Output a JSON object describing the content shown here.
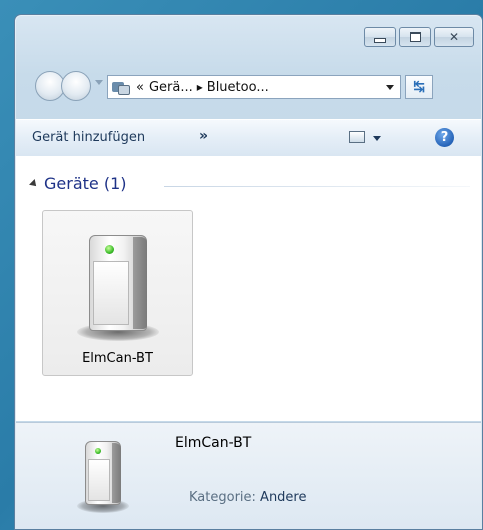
{
  "window": {
    "caption_buttons": [
      "minimize",
      "maximize",
      "close"
    ]
  },
  "address": {
    "overflow_chevron": "«",
    "crumbs": [
      "Gerä...",
      "Bluetoo..."
    ],
    "separator": "▸"
  },
  "toolbar": {
    "add_device": "Gerät hinzufügen",
    "more": "»",
    "help": "?"
  },
  "group": {
    "title": "Geräte (1)"
  },
  "devices": [
    {
      "name": "ElmCan-BT"
    }
  ],
  "details": {
    "name": "ElmCan-BT",
    "category_label": "Kategorie:",
    "category_value": "Andere"
  },
  "icons": {
    "device": "tower-device-icon",
    "led_color": "#3cbc2a",
    "accent": "#1e3287"
  }
}
